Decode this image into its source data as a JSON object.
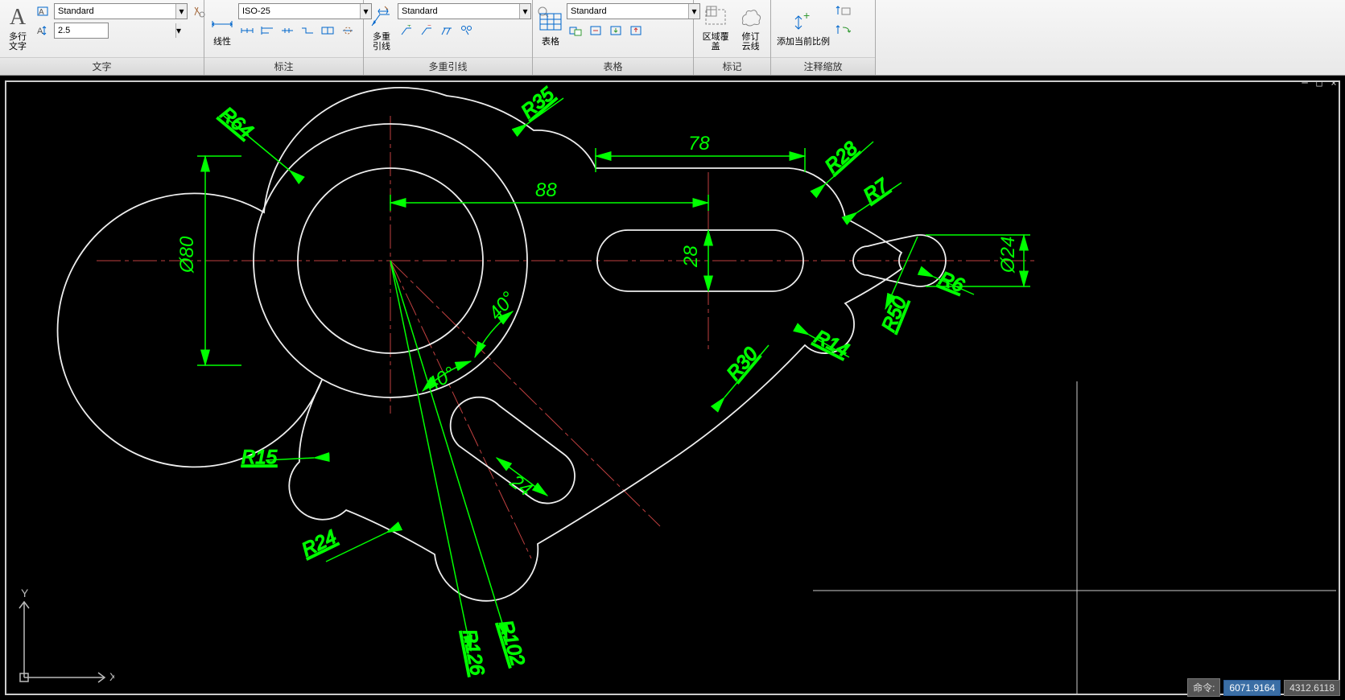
{
  "ribbon": {
    "text": {
      "title": "文字",
      "mtext_label": "多行\n文字",
      "style_combo": "Standard",
      "height_combo": "2.5"
    },
    "dim": {
      "title": "标注",
      "linear_label": "线性",
      "style_combo": "ISO-25"
    },
    "mleader": {
      "title": "多重引线",
      "label": "多重引线",
      "style_combo": "Standard"
    },
    "table": {
      "title": "表格",
      "label": "表格",
      "style_combo": "Standard"
    },
    "markup": {
      "title": "标记",
      "wipeout": "区域覆盖",
      "revcloud": "修订\n云线"
    },
    "annoscale": {
      "title": "注释缩放",
      "add_label": "添加当前比例"
    }
  },
  "drawing": {
    "dims": {
      "d88": "88",
      "d78": "78",
      "d28": "28",
      "d24hole": "24",
      "dia80": "Ø80",
      "dia24": "Ø24",
      "a40a": "40°",
      "a40b": "40°",
      "r64": "R64",
      "r35": "R35",
      "r28": "R28",
      "r7": "R7",
      "r6": "R6",
      "r50": "R50",
      "r14": "R14",
      "r30": "R30",
      "r15": "R15",
      "r24": "R24",
      "r102": "R102",
      "r126": "R126"
    },
    "ucs": {
      "x": "X",
      "y": "Y"
    }
  },
  "status": {
    "cmd_label": "命令:",
    "coord_x": "6071.9164",
    "coord_y": "4312.6118"
  }
}
